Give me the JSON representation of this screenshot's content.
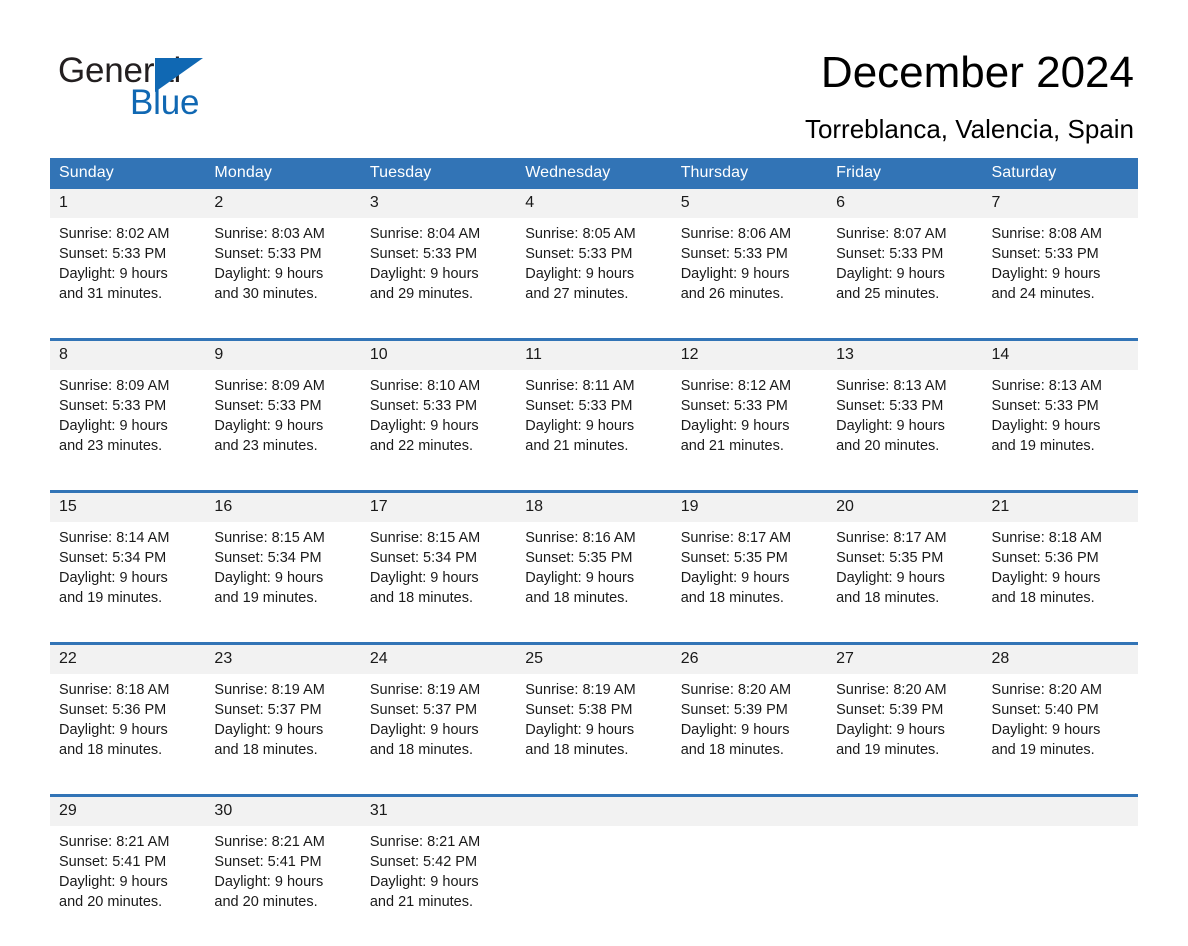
{
  "brand": {
    "name_part1": "General",
    "name_part2": "Blue",
    "logo_icon": "triangle-logo-icon",
    "accent_color": "#1068b3"
  },
  "header": {
    "title": "December 2024",
    "location": "Torreblanca, Valencia, Spain"
  },
  "calendar": {
    "header_bg": "#3274b6",
    "row_border_color": "#3274b6",
    "number_band_bg": "#f2f2f2",
    "weekdays": [
      "Sunday",
      "Monday",
      "Tuesday",
      "Wednesday",
      "Thursday",
      "Friday",
      "Saturday"
    ],
    "weeks": [
      [
        {
          "day": "1",
          "sunrise": "Sunrise: 8:02 AM",
          "sunset": "Sunset: 5:33 PM",
          "daylight_line1": "Daylight: 9 hours",
          "daylight_line2": "and 31 minutes."
        },
        {
          "day": "2",
          "sunrise": "Sunrise: 8:03 AM",
          "sunset": "Sunset: 5:33 PM",
          "daylight_line1": "Daylight: 9 hours",
          "daylight_line2": "and 30 minutes."
        },
        {
          "day": "3",
          "sunrise": "Sunrise: 8:04 AM",
          "sunset": "Sunset: 5:33 PM",
          "daylight_line1": "Daylight: 9 hours",
          "daylight_line2": "and 29 minutes."
        },
        {
          "day": "4",
          "sunrise": "Sunrise: 8:05 AM",
          "sunset": "Sunset: 5:33 PM",
          "daylight_line1": "Daylight: 9 hours",
          "daylight_line2": "and 27 minutes."
        },
        {
          "day": "5",
          "sunrise": "Sunrise: 8:06 AM",
          "sunset": "Sunset: 5:33 PM",
          "daylight_line1": "Daylight: 9 hours",
          "daylight_line2": "and 26 minutes."
        },
        {
          "day": "6",
          "sunrise": "Sunrise: 8:07 AM",
          "sunset": "Sunset: 5:33 PM",
          "daylight_line1": "Daylight: 9 hours",
          "daylight_line2": "and 25 minutes."
        },
        {
          "day": "7",
          "sunrise": "Sunrise: 8:08 AM",
          "sunset": "Sunset: 5:33 PM",
          "daylight_line1": "Daylight: 9 hours",
          "daylight_line2": "and 24 minutes."
        }
      ],
      [
        {
          "day": "8",
          "sunrise": "Sunrise: 8:09 AM",
          "sunset": "Sunset: 5:33 PM",
          "daylight_line1": "Daylight: 9 hours",
          "daylight_line2": "and 23 minutes."
        },
        {
          "day": "9",
          "sunrise": "Sunrise: 8:09 AM",
          "sunset": "Sunset: 5:33 PM",
          "daylight_line1": "Daylight: 9 hours",
          "daylight_line2": "and 23 minutes."
        },
        {
          "day": "10",
          "sunrise": "Sunrise: 8:10 AM",
          "sunset": "Sunset: 5:33 PM",
          "daylight_line1": "Daylight: 9 hours",
          "daylight_line2": "and 22 minutes."
        },
        {
          "day": "11",
          "sunrise": "Sunrise: 8:11 AM",
          "sunset": "Sunset: 5:33 PM",
          "daylight_line1": "Daylight: 9 hours",
          "daylight_line2": "and 21 minutes."
        },
        {
          "day": "12",
          "sunrise": "Sunrise: 8:12 AM",
          "sunset": "Sunset: 5:33 PM",
          "daylight_line1": "Daylight: 9 hours",
          "daylight_line2": "and 21 minutes."
        },
        {
          "day": "13",
          "sunrise": "Sunrise: 8:13 AM",
          "sunset": "Sunset: 5:33 PM",
          "daylight_line1": "Daylight: 9 hours",
          "daylight_line2": "and 20 minutes."
        },
        {
          "day": "14",
          "sunrise": "Sunrise: 8:13 AM",
          "sunset": "Sunset: 5:33 PM",
          "daylight_line1": "Daylight: 9 hours",
          "daylight_line2": "and 19 minutes."
        }
      ],
      [
        {
          "day": "15",
          "sunrise": "Sunrise: 8:14 AM",
          "sunset": "Sunset: 5:34 PM",
          "daylight_line1": "Daylight: 9 hours",
          "daylight_line2": "and 19 minutes."
        },
        {
          "day": "16",
          "sunrise": "Sunrise: 8:15 AM",
          "sunset": "Sunset: 5:34 PM",
          "daylight_line1": "Daylight: 9 hours",
          "daylight_line2": "and 19 minutes."
        },
        {
          "day": "17",
          "sunrise": "Sunrise: 8:15 AM",
          "sunset": "Sunset: 5:34 PM",
          "daylight_line1": "Daylight: 9 hours",
          "daylight_line2": "and 18 minutes."
        },
        {
          "day": "18",
          "sunrise": "Sunrise: 8:16 AM",
          "sunset": "Sunset: 5:35 PM",
          "daylight_line1": "Daylight: 9 hours",
          "daylight_line2": "and 18 minutes."
        },
        {
          "day": "19",
          "sunrise": "Sunrise: 8:17 AM",
          "sunset": "Sunset: 5:35 PM",
          "daylight_line1": "Daylight: 9 hours",
          "daylight_line2": "and 18 minutes."
        },
        {
          "day": "20",
          "sunrise": "Sunrise: 8:17 AM",
          "sunset": "Sunset: 5:35 PM",
          "daylight_line1": "Daylight: 9 hours",
          "daylight_line2": "and 18 minutes."
        },
        {
          "day": "21",
          "sunrise": "Sunrise: 8:18 AM",
          "sunset": "Sunset: 5:36 PM",
          "daylight_line1": "Daylight: 9 hours",
          "daylight_line2": "and 18 minutes."
        }
      ],
      [
        {
          "day": "22",
          "sunrise": "Sunrise: 8:18 AM",
          "sunset": "Sunset: 5:36 PM",
          "daylight_line1": "Daylight: 9 hours",
          "daylight_line2": "and 18 minutes."
        },
        {
          "day": "23",
          "sunrise": "Sunrise: 8:19 AM",
          "sunset": "Sunset: 5:37 PM",
          "daylight_line1": "Daylight: 9 hours",
          "daylight_line2": "and 18 minutes."
        },
        {
          "day": "24",
          "sunrise": "Sunrise: 8:19 AM",
          "sunset": "Sunset: 5:37 PM",
          "daylight_line1": "Daylight: 9 hours",
          "daylight_line2": "and 18 minutes."
        },
        {
          "day": "25",
          "sunrise": "Sunrise: 8:19 AM",
          "sunset": "Sunset: 5:38 PM",
          "daylight_line1": "Daylight: 9 hours",
          "daylight_line2": "and 18 minutes."
        },
        {
          "day": "26",
          "sunrise": "Sunrise: 8:20 AM",
          "sunset": "Sunset: 5:39 PM",
          "daylight_line1": "Daylight: 9 hours",
          "daylight_line2": "and 18 minutes."
        },
        {
          "day": "27",
          "sunrise": "Sunrise: 8:20 AM",
          "sunset": "Sunset: 5:39 PM",
          "daylight_line1": "Daylight: 9 hours",
          "daylight_line2": "and 19 minutes."
        },
        {
          "day": "28",
          "sunrise": "Sunrise: 8:20 AM",
          "sunset": "Sunset: 5:40 PM",
          "daylight_line1": "Daylight: 9 hours",
          "daylight_line2": "and 19 minutes."
        }
      ],
      [
        {
          "day": "29",
          "sunrise": "Sunrise: 8:21 AM",
          "sunset": "Sunset: 5:41 PM",
          "daylight_line1": "Daylight: 9 hours",
          "daylight_line2": "and 20 minutes."
        },
        {
          "day": "30",
          "sunrise": "Sunrise: 8:21 AM",
          "sunset": "Sunset: 5:41 PM",
          "daylight_line1": "Daylight: 9 hours",
          "daylight_line2": "and 20 minutes."
        },
        {
          "day": "31",
          "sunrise": "Sunrise: 8:21 AM",
          "sunset": "Sunset: 5:42 PM",
          "daylight_line1": "Daylight: 9 hours",
          "daylight_line2": "and 21 minutes."
        },
        {
          "day": "",
          "sunrise": "",
          "sunset": "",
          "daylight_line1": "",
          "daylight_line2": ""
        },
        {
          "day": "",
          "sunrise": "",
          "sunset": "",
          "daylight_line1": "",
          "daylight_line2": ""
        },
        {
          "day": "",
          "sunrise": "",
          "sunset": "",
          "daylight_line1": "",
          "daylight_line2": ""
        },
        {
          "day": "",
          "sunrise": "",
          "sunset": "",
          "daylight_line1": "",
          "daylight_line2": ""
        }
      ]
    ]
  }
}
